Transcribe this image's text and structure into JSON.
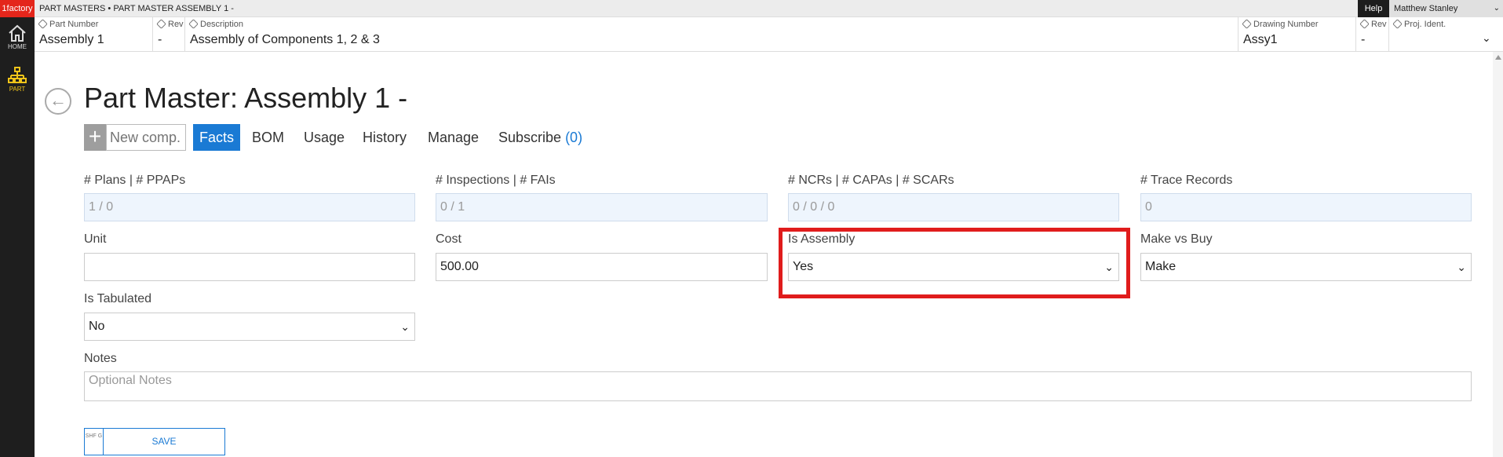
{
  "app": {
    "logo": "1factory",
    "breadcrumb": "PART MASTERS • PART MASTER ASSEMBLY 1 -",
    "help_label": "Help",
    "user_name": "Matthew Stanley"
  },
  "rail": {
    "home_label": "HOME",
    "part_label": "PART"
  },
  "header": {
    "part_number": {
      "label": "Part Number",
      "value": "Assembly 1"
    },
    "rev": {
      "label": "Rev",
      "value": "-"
    },
    "description": {
      "label": "Description",
      "value": "Assembly of Components 1, 2 & 3"
    },
    "drawing_number": {
      "label": "Drawing Number",
      "value": "Assy1"
    },
    "drawing_rev": {
      "label": "Rev",
      "value": "-"
    },
    "proj_ident": {
      "label": "Proj. Ident.",
      "value": ""
    }
  },
  "page": {
    "title": "Part Master: Assembly 1 -"
  },
  "tabs": {
    "new_comp_placeholder": "New comp.",
    "facts": "Facts",
    "bom": "BOM",
    "usage": "Usage",
    "history": "History",
    "manage": "Manage",
    "subscribe": "Subscribe",
    "subscribe_count": "(0)"
  },
  "form": {
    "plans": {
      "label": "# Plans | # PPAPs",
      "value": "1 / 0"
    },
    "inspections": {
      "label": "# Inspections | # FAIs",
      "value": "0 / 1"
    },
    "ncrs": {
      "label": "# NCRs | # CAPAs | # SCARs",
      "value": "0 / 0 / 0"
    },
    "trace": {
      "label": "# Trace Records",
      "value": "0"
    },
    "unit": {
      "label": "Unit",
      "value": ""
    },
    "cost": {
      "label": "Cost",
      "value": "500.00"
    },
    "is_assembly": {
      "label": "Is Assembly",
      "value": "Yes"
    },
    "make_vs_buy": {
      "label": "Make vs Buy",
      "value": "Make"
    },
    "is_tabulated": {
      "label": "Is Tabulated",
      "value": "No"
    },
    "notes": {
      "label": "Notes",
      "placeholder": "Optional Notes"
    }
  },
  "save": {
    "shortcut": "SHF G",
    "label": "SAVE"
  },
  "colors": {
    "accent": "#1a7ad4",
    "logo_bg": "#e4261b",
    "highlight": "#e01c1c",
    "rail_active": "#f0c419"
  }
}
